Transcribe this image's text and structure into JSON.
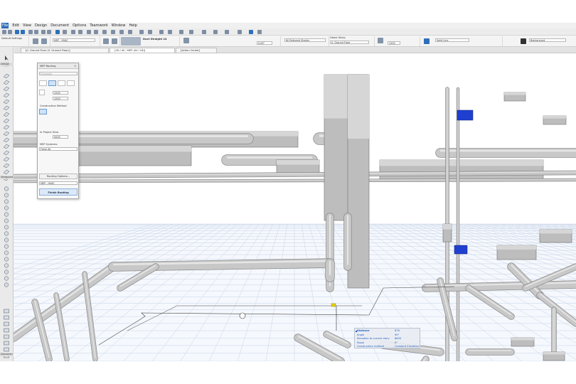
{
  "menu": [
    "File",
    "Edit",
    "View",
    "Design",
    "Document",
    "Options",
    "Teamwork",
    "Window",
    "Help"
  ],
  "infobox": {
    "favorites": "Default Settings",
    "layer": "MEP - HVAC",
    "element_type": "Duct Straight 24",
    "offset": "0.00\"",
    "view_filter": "All Relevant Stories",
    "home_story_label": "Home Story:",
    "home_story": "0. Ground Floor",
    "width": "1200",
    "line_type": "Solid Line",
    "background": "Background"
  },
  "tabs": [
    "[0. Ground Floor (0. Ground Floor)]",
    "[3D / All / MEP (All / LB)]",
    "[Action Center]"
  ],
  "toolbox": {
    "sections": [
      "Design",
      "Viewpoint",
      "Document"
    ],
    "selected_section": "Documen"
  },
  "palette": {
    "title": "MEP Routing",
    "route_default": "Ductwork",
    "width_value": "2200",
    "height_value": "1200",
    "construction_method_label": "Construction Method",
    "in_project_zero_label": "In Project Zero",
    "zero_value": "0000",
    "mep_systems_label": "MEP Systems:",
    "mep_system": "Fresh Air",
    "routing_options": "Routing Options...",
    "layer": "MEP - HVAC",
    "finish_routing": "Finish Routing"
  },
  "tracker": {
    "rows": [
      {
        "label": "Distance",
        "value": "876"
      },
      {
        "label": "Angle",
        "value": "90°"
      },
      {
        "label": "Elevation to current story",
        "value": "8850"
      },
      {
        "label": "Slope",
        "value": "0°"
      },
      {
        "label": "Construction method",
        "value": "Constant Elevation"
      }
    ]
  },
  "colors": {
    "selection_blue": "#1f3fd0",
    "duct_gray": "#c8c8c8",
    "grid_blue": "#c7d3e6"
  }
}
